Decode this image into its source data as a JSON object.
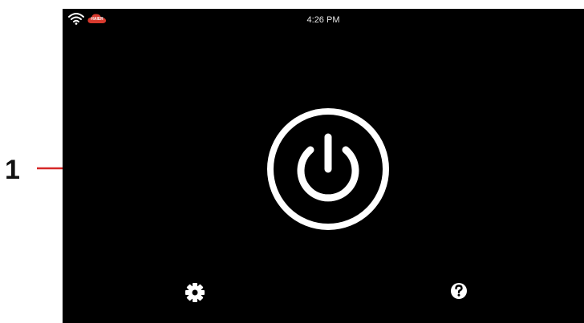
{
  "callout": {
    "number": "1"
  },
  "status_bar": {
    "time": "4:26 PM",
    "wifi_icon": "wifi-icon",
    "cloud_badge_icon": "cloud-icon",
    "cloud_badge_text": "HAIER"
  },
  "main": {
    "power_icon": "power-icon"
  },
  "bottom_bar": {
    "settings_icon": "gear-icon",
    "help_icon": "help-icon"
  },
  "colors": {
    "screen_background": "#000000",
    "callout_arrow": "#d62828",
    "cloud_badge": "#d83a2e",
    "icon_foreground": "#ffffff"
  }
}
